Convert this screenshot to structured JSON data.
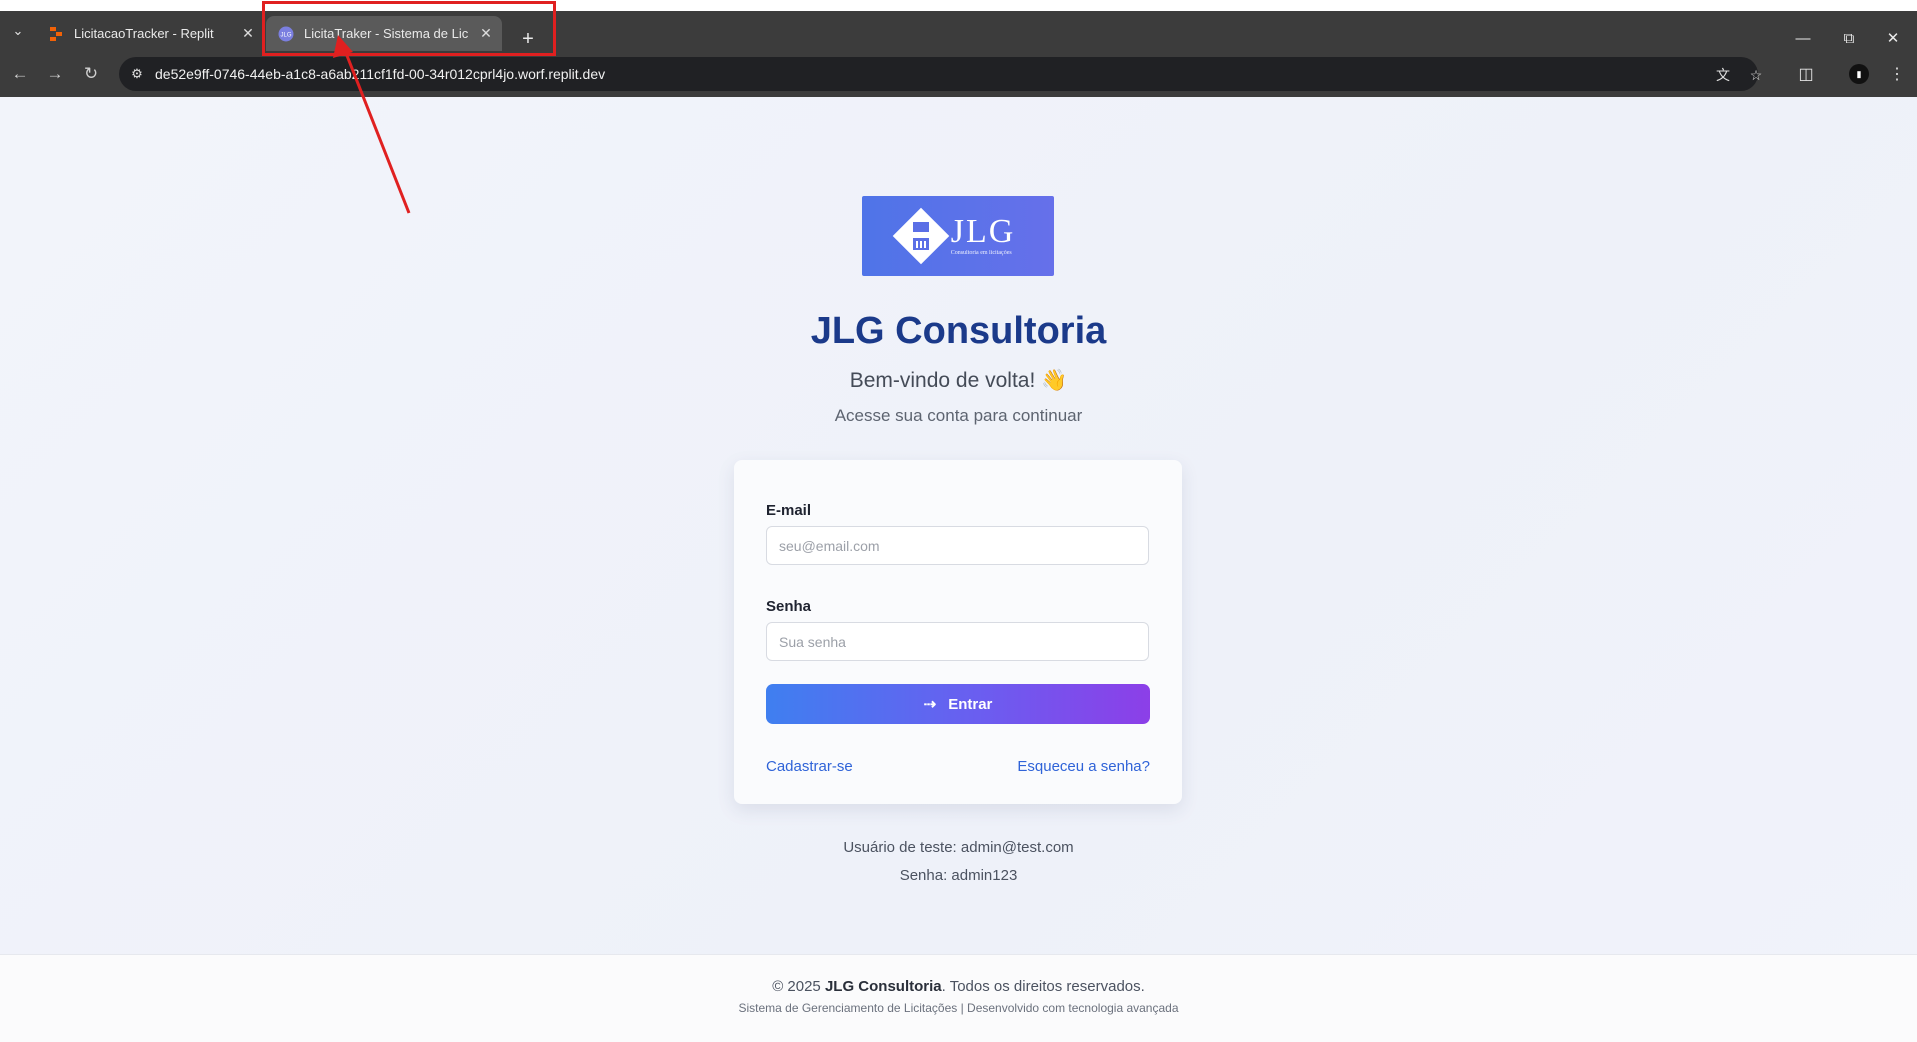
{
  "browser": {
    "tabs": [
      {
        "title": "LicitacaoTracker - Replit",
        "favicon": "replit-icon",
        "active": false
      },
      {
        "title": "LicitaTraker - Sistema de Licitaç",
        "favicon": "app-favicon",
        "active": true
      }
    ],
    "url": "de52e9ff-0746-44eb-a1c8-a6ab211cf1fd-00-34r012cprl4jo.worf.replit.dev"
  },
  "page": {
    "logo": {
      "text": "JLG",
      "subtext": "Consultoria em licitações"
    },
    "brand": "JLG Consultoria",
    "welcome": "Bem-vindo de volta! 👋",
    "subtitle": "Acesse sua conta para continuar",
    "form": {
      "email_label": "E-mail",
      "email_placeholder": "seu@email.com",
      "password_label": "Senha",
      "password_placeholder": "Sua senha",
      "submit_label": "Entrar",
      "register_link": "Cadastrar-se",
      "forgot_link": "Esqueceu a senha?"
    },
    "test_user": "Usuário de teste: admin@test.com",
    "test_password": "Senha: admin123",
    "footer": {
      "copyright_prefix": "© 2025 ",
      "company": "JLG Consultoria",
      "copyright_suffix": ". Todos os direitos reservados.",
      "tagline": "Sistema de Gerenciamento de Licitações | Desenvolvido com tecnologia avançada"
    }
  },
  "annotation": {
    "color": "#e02020"
  }
}
